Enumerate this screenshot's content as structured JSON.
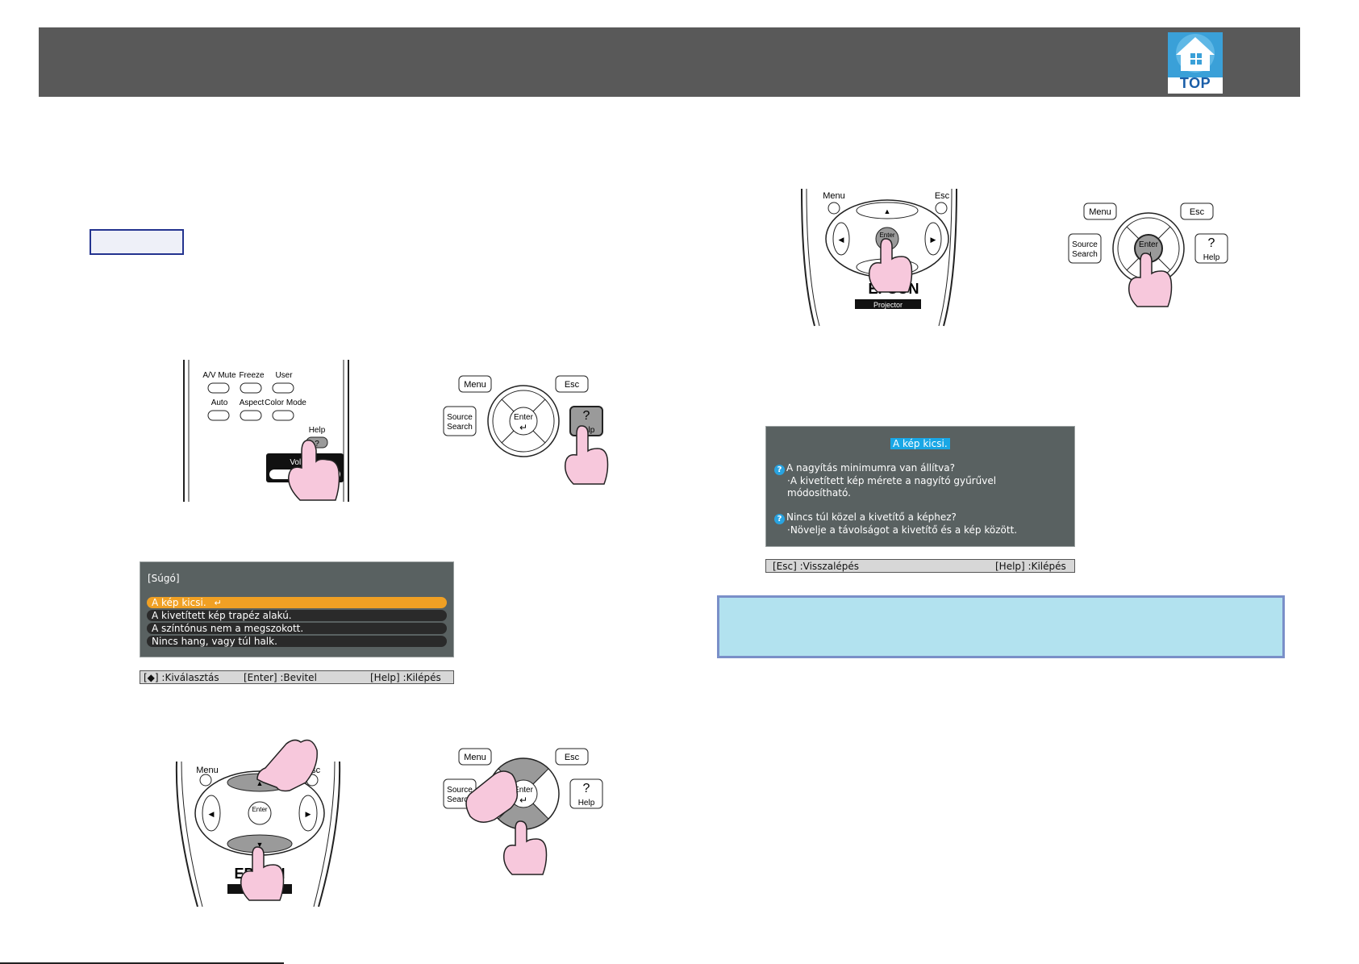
{
  "header": {
    "top_link_label": "TOP",
    "top_icon": "home-icon"
  },
  "remote_controls": {
    "help_area": {
      "buttons": [
        "A/V Mute",
        "Freeze",
        "User",
        "Auto",
        "Aspect",
        "Color Mode"
      ],
      "help_label": "Help",
      "help_glyph": "?",
      "volume_label": "Volume"
    },
    "nav_area": {
      "menu_label": "Menu",
      "esc_label": "Esc",
      "enter_label": "Enter",
      "brand_label": "EPSON",
      "brand_sub": "Projector"
    }
  },
  "control_panel": {
    "menu_label": "Menu",
    "esc_label": "Esc",
    "source_search_line1": "Source",
    "source_search_line2": "Search",
    "enter_label": "Enter",
    "help_glyph": "?",
    "help_label": "Help"
  },
  "help_menu": {
    "title": "[Súgó]",
    "items": [
      {
        "label": "A kép kicsi.",
        "selected": true
      },
      {
        "label": "A kivetített kép trapéz alakú.",
        "selected": false
      },
      {
        "label": "A színtónus nem a megszokott.",
        "selected": false
      },
      {
        "label": "Nincs hang, vagy túl halk.",
        "selected": false
      }
    ],
    "enter_glyph": "↵",
    "status": {
      "select": "[◆] :Kiválasztás",
      "enter": "[Enter] :Bevitel",
      "exit": "[Help] :Kilépés"
    }
  },
  "help_answer": {
    "title": "A kép kicsi.",
    "question_glyph": "?",
    "q1": "A nagyítás minimumra van állítva?",
    "a1_line1": "·A kivetített kép mérete a nagyító gyűrűvel",
    "a1_line2": "módosítható.",
    "q2": "Nincs túl közel a kivetítő a képhez?",
    "a2": "·Növelje a távolságot a kivetítő és a kép között.",
    "status": {
      "back": "[Esc] :Visszalépés",
      "exit": "[Help] :Kilépés"
    }
  },
  "colors": {
    "header_bar": "#595959",
    "menu_screen": "#596161",
    "selected_item": "#f0a024",
    "note_bg": "#b2e2ef",
    "note_border": "#7a8fc8",
    "finger": "#f7c8dc",
    "pressed_button": "#9a9a9a"
  }
}
